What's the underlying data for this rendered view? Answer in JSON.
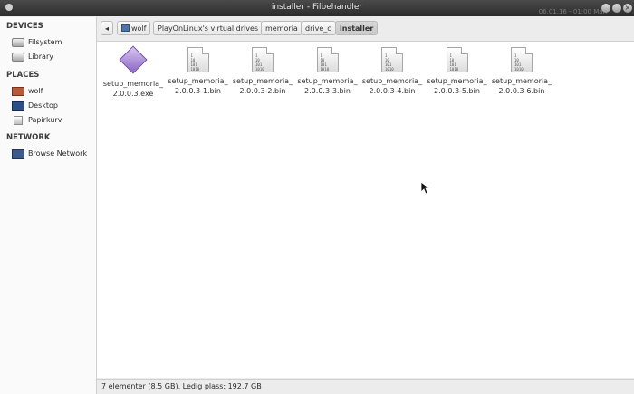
{
  "window": {
    "title": "installer - Filbehandler",
    "clock": "06.01.16 - 01:00 Man"
  },
  "breadcrumbs": {
    "back": "◂",
    "items": [
      "wolf",
      "PlayOnLinux's virtual drives",
      "memoria",
      "drive_c",
      "installer"
    ]
  },
  "sidebar": {
    "devices_header": "DEVICES",
    "devices": [
      "Filsystem",
      "Library"
    ],
    "places_header": "PLACES",
    "places": [
      "wolf",
      "Desktop",
      "Papirkurv"
    ],
    "network_header": "NETWORK",
    "network": [
      "Browse Network"
    ]
  },
  "files": [
    {
      "line1": "setup_memoria_",
      "line2": "2.0.0.3.exe",
      "icon": "exe-icon"
    },
    {
      "line1": "setup_memoria_",
      "line2": "2.0.0.3-1.bin",
      "icon": "binary-file-icon"
    },
    {
      "line1": "setup_memoria_",
      "line2": "2.0.0.3-2.bin",
      "icon": "binary-file-icon"
    },
    {
      "line1": "setup_memoria_",
      "line2": "2.0.0.3-3.bin",
      "icon": "binary-file-icon"
    },
    {
      "line1": "setup_memoria_",
      "line2": "2.0.0.3-4.bin",
      "icon": "binary-file-icon"
    },
    {
      "line1": "setup_memoria_",
      "line2": "2.0.0.3-5.bin",
      "icon": "binary-file-icon"
    },
    {
      "line1": "setup_memoria_",
      "line2": "2.0.0.3-6.bin",
      "icon": "binary-file-icon"
    }
  ],
  "binary_glyph": "1\n10\n101\n1010",
  "status": "7 elementer (8,5 GB), Ledig plass: 192,7 GB"
}
